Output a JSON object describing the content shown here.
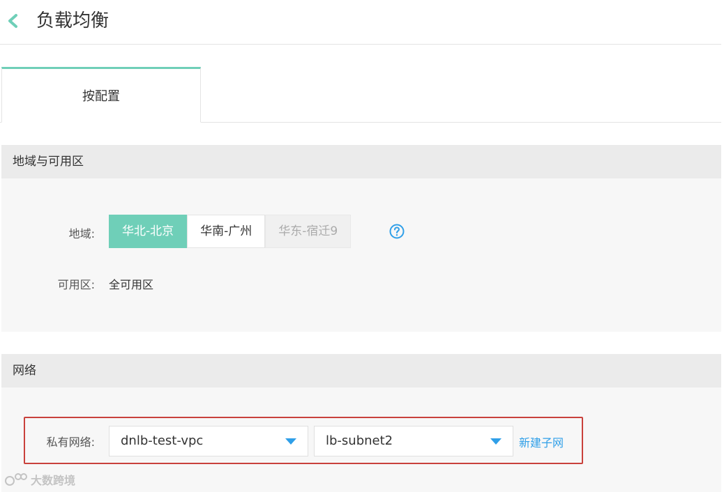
{
  "header": {
    "title": "负载均衡",
    "back_icon": "chevron-left-icon"
  },
  "tabs": [
    {
      "label": "按配置",
      "active": true
    }
  ],
  "region_section": {
    "title": "地域与可用区",
    "region_label": "地域:",
    "regions": [
      {
        "label": "华北-北京",
        "state": "active"
      },
      {
        "label": "华南-广州",
        "state": "normal"
      },
      {
        "label": "华东-宿迁9",
        "state": "disabled"
      }
    ],
    "help_icon": "question-circle-icon",
    "zone_label": "可用区:",
    "zone_value": "全可用区"
  },
  "network_section": {
    "title": "网络",
    "vpc_label": "私有网络:",
    "vpc_value": "dnlb-test-vpc",
    "subnet_value": "lb-subnet2",
    "new_subnet_link": "新建子网"
  },
  "watermark": {
    "text": "大数跨境"
  },
  "colors": {
    "accent": "#6fcfb8",
    "link": "#2f9fe8",
    "highlight": "#c9413c"
  }
}
